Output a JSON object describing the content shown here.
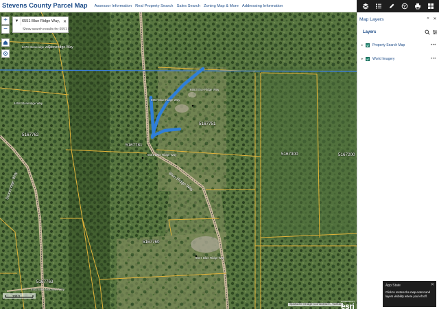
{
  "header": {
    "title": "Stevens County Parcel Map",
    "nav": [
      "Assessor Information",
      "Real Property Search",
      "Sales Search",
      "Zoning Map & More",
      "Addressing Information"
    ],
    "icons": [
      "layers-icon",
      "legend-icon",
      "draw-icon",
      "basemap-icon",
      "print-icon",
      "widgets-icon"
    ]
  },
  "search": {
    "value": "6551 Blue Ridge Way, Dpk",
    "suggestion": "Show search results for 6551 Bl"
  },
  "map": {
    "parcels": [
      "5167762",
      "5167781",
      "5167751",
      "5167300",
      "5167200",
      "5167760",
      "5167763"
    ],
    "roads": [
      "Blue Ridge Way",
      "Stoneridge Way",
      "Stoneridge Way"
    ],
    "addresses": [
      "6553 Blue Ridge Way",
      "6551 Blue Ridge Way",
      "6547 Blue Ridge Way",
      "6470 Stoneridge Way",
      "6458 Stoneridge Way",
      "6557 Blue Ridge Way",
      "6502 Blue Mountain Way"
    ],
    "attribution": "Spokane Image Consortium, Vantar",
    "esri": "esri",
    "esri_powered": "POWERED BY",
    "scale": "300 ft"
  },
  "panel": {
    "title": "Map Layers",
    "layers_label": "Layers",
    "items": [
      {
        "name": "Property Search Map",
        "checked": true
      },
      {
        "name": "World Imagery",
        "checked": true
      }
    ]
  },
  "toast": {
    "title": "App State",
    "body": "Click to restore the map extent and layers visibility where you left off."
  },
  "colors": {
    "accent": "#1a4a87",
    "parcel_line": "#e4b43a",
    "highlight": "#2f7fd8"
  }
}
